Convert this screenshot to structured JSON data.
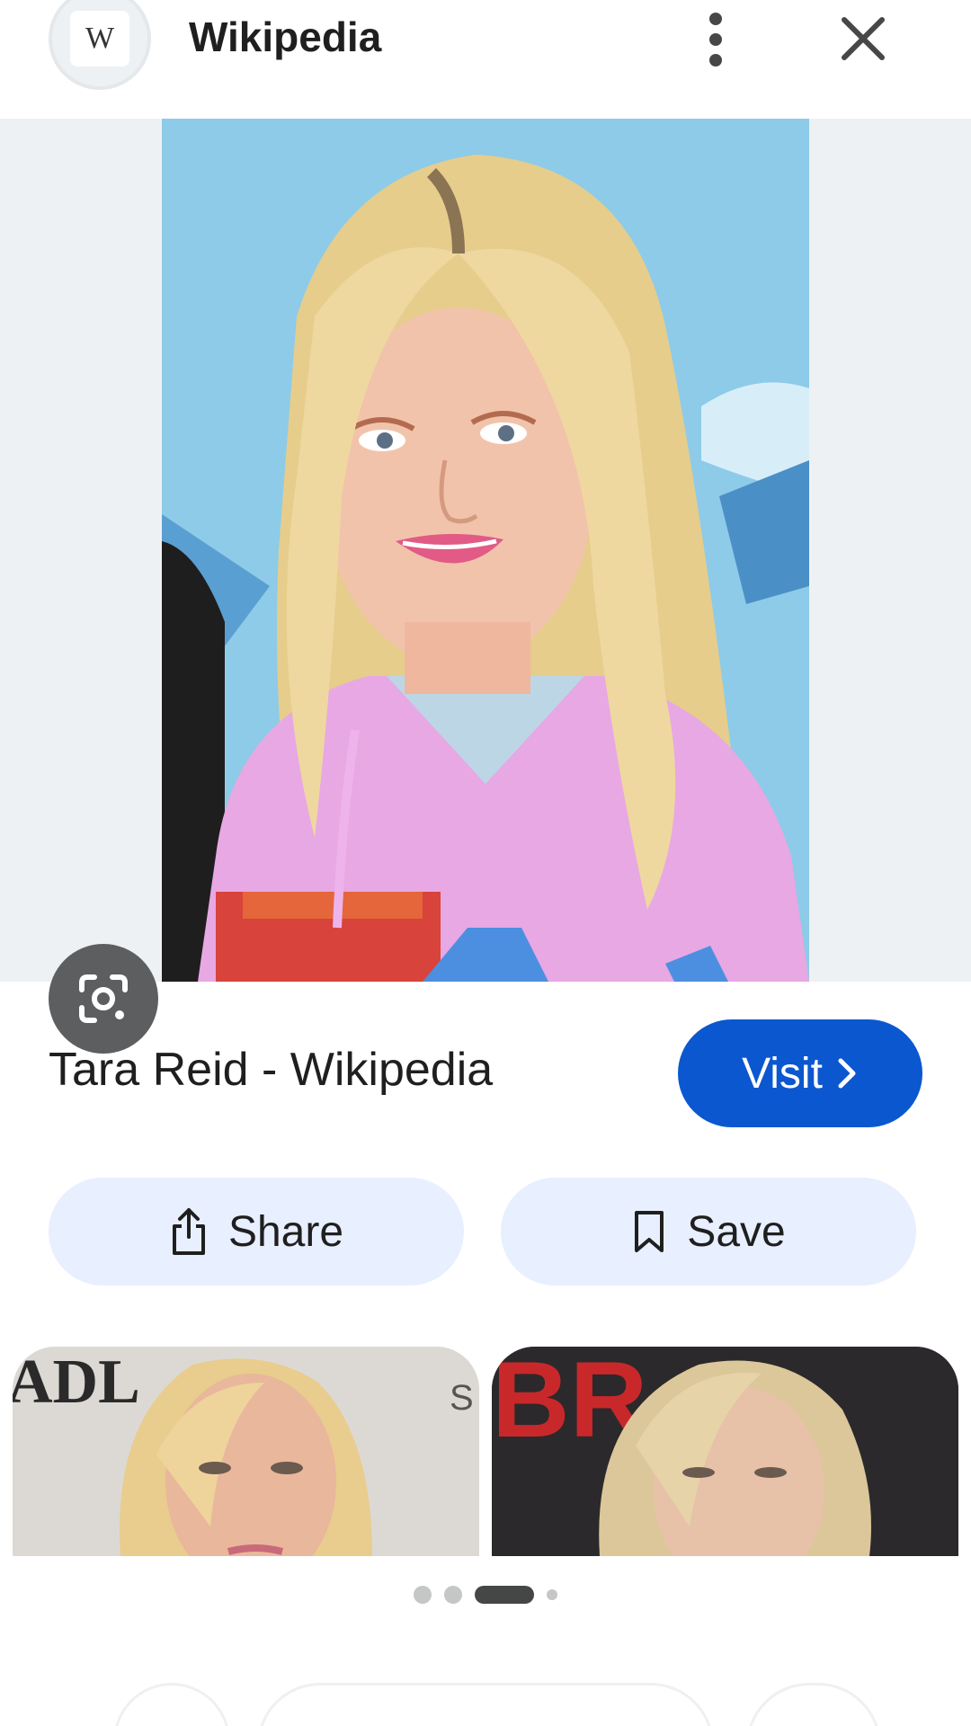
{
  "header": {
    "favicon_letter": "W",
    "site_name": "Wikipedia",
    "more_icon": "more-vert-icon",
    "close_icon": "close-icon"
  },
  "image": {
    "lens_icon": "google-lens-icon"
  },
  "result": {
    "title": "Tara Reid - Wikipedia",
    "visit_label": "Visit"
  },
  "actions": {
    "share_label": "Share",
    "save_label": "Save"
  },
  "related": {
    "thumbs": [
      {
        "overlay_text_top": "ADL",
        "overlay_text_side": "S"
      },
      {
        "overlay_text_top": "BR"
      }
    ]
  },
  "pager": {
    "count": 4,
    "active_index": 2
  },
  "colors": {
    "accent": "#0b57d0",
    "tonal_button": "#e8efff",
    "image_backdrop": "#eef1f3"
  }
}
